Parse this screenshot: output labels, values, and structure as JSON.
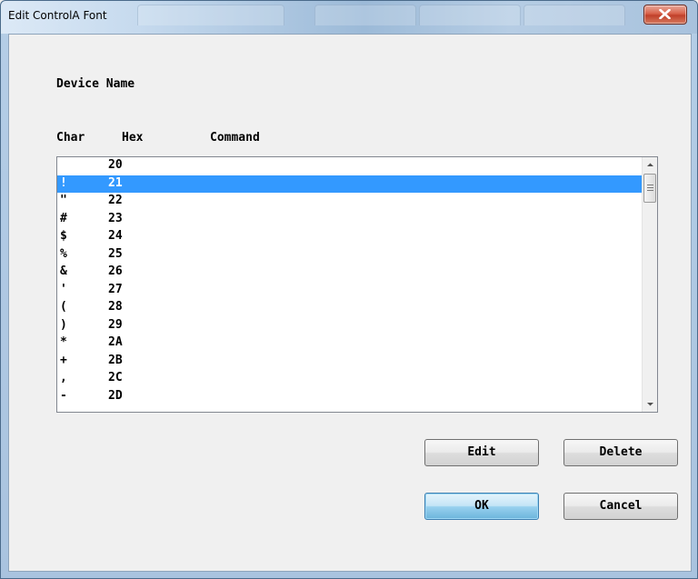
{
  "window": {
    "title": "Edit ControlA Font",
    "close_icon": "close-icon",
    "close_color": "#c9452e"
  },
  "dialog": {
    "device_name_label": "Device Name",
    "columns": {
      "char": "Char",
      "hex": "Hex",
      "command": "Command"
    }
  },
  "list": {
    "selected_index": 1,
    "rows": [
      {
        "char": "",
        "hex": "20"
      },
      {
        "char": "!",
        "hex": "21"
      },
      {
        "char": "\"",
        "hex": "22"
      },
      {
        "char": "#",
        "hex": "23"
      },
      {
        "char": "$",
        "hex": "24"
      },
      {
        "char": "%",
        "hex": "25"
      },
      {
        "char": "&",
        "hex": "26"
      },
      {
        "char": "'",
        "hex": "27"
      },
      {
        "char": "(",
        "hex": "28"
      },
      {
        "char": ")",
        "hex": "29"
      },
      {
        "char": "*",
        "hex": "2A"
      },
      {
        "char": "+",
        "hex": "2B"
      },
      {
        "char": ",",
        "hex": "2C"
      },
      {
        "char": "-",
        "hex": "2D"
      }
    ],
    "selection_color": "#3399ff"
  },
  "buttons": {
    "edit": "Edit",
    "delete": "Delete",
    "ok": "OK",
    "cancel": "Cancel"
  }
}
